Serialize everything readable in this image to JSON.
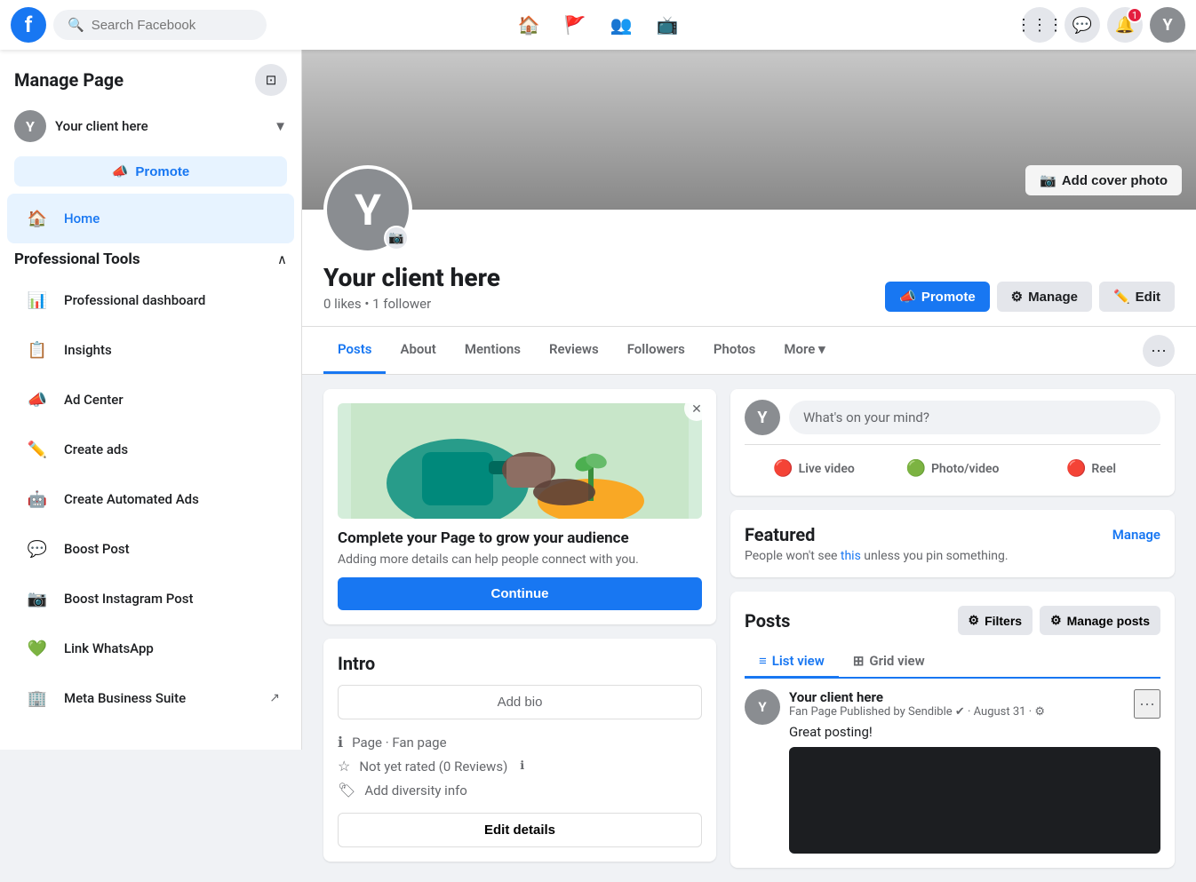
{
  "topnav": {
    "logo": "f",
    "search_placeholder": "Search Facebook",
    "icons": [
      "home",
      "flag",
      "people",
      "tv"
    ],
    "right_icons": [
      "grid",
      "messenger",
      "bell",
      "avatar"
    ],
    "notification_count": "1",
    "avatar_letter": "Y"
  },
  "sidebar": {
    "title": "Manage Page",
    "page_name": "Your client here",
    "avatar_letter": "Y",
    "promote_label": "Promote",
    "nav_items": [
      {
        "id": "home",
        "label": "Home",
        "icon": "🏠",
        "active": true
      },
      {
        "id": "professional-tools-header",
        "label": "Professional Tools",
        "is_section": true
      },
      {
        "id": "professional-dashboard",
        "label": "Professional dashboard",
        "icon": "📊"
      },
      {
        "id": "insights",
        "label": "Insights",
        "icon": "📋"
      },
      {
        "id": "ad-center",
        "label": "Ad Center",
        "icon": "📣"
      },
      {
        "id": "create-ads",
        "label": "Create ads",
        "icon": "✏️"
      },
      {
        "id": "create-automated-ads",
        "label": "Create Automated Ads",
        "icon": "🤖"
      },
      {
        "id": "boost-post",
        "label": "Boost Post",
        "icon": "💬"
      },
      {
        "id": "boost-instagram",
        "label": "Boost Instagram Post",
        "icon": "📷"
      },
      {
        "id": "link-whatsapp",
        "label": "Link WhatsApp",
        "icon": "💚"
      },
      {
        "id": "meta-business-suite",
        "label": "Meta Business Suite",
        "icon": "🏢",
        "external": true
      }
    ]
  },
  "cover": {
    "add_cover_label": "Add cover photo",
    "camera_icon": "📷"
  },
  "profile": {
    "avatar_letter": "Y",
    "name": "Your client here",
    "meta": "0 likes • 1 follower",
    "actions": {
      "promote": "Promote",
      "manage": "Manage",
      "edit": "Edit"
    }
  },
  "tabs": [
    {
      "id": "posts",
      "label": "Posts",
      "active": true
    },
    {
      "id": "about",
      "label": "About"
    },
    {
      "id": "mentions",
      "label": "Mentions"
    },
    {
      "id": "reviews",
      "label": "Reviews"
    },
    {
      "id": "followers",
      "label": "Followers"
    },
    {
      "id": "photos",
      "label": "Photos"
    },
    {
      "id": "more",
      "label": "More ▾"
    }
  ],
  "grow_card": {
    "title": "Complete your Page to grow your audience",
    "desc": "Adding more details can help people connect with you.",
    "continue_label": "Continue"
  },
  "intro": {
    "title": "Intro",
    "add_bio_label": "Add bio",
    "page_type": "Page · Fan page",
    "rating": "Not yet rated (0 Reviews)",
    "diversity_info": "Add diversity info",
    "edit_details_label": "Edit details"
  },
  "composer": {
    "avatar_letter": "Y",
    "placeholder": "What's on your mind?",
    "actions": [
      {
        "id": "live-video",
        "label": "Live video",
        "icon": "🔴"
      },
      {
        "id": "photo-video",
        "label": "Photo/video",
        "icon": "🟢"
      },
      {
        "id": "reel",
        "label": "Reel",
        "icon": "🔴"
      }
    ]
  },
  "featured": {
    "title": "Featured",
    "desc": "People won't see ",
    "desc_link": "this",
    "desc_end": " unless you pin something.",
    "manage_label": "Manage"
  },
  "posts_section": {
    "title": "Posts",
    "filters_label": "Filters",
    "manage_posts_label": "Manage posts",
    "view_tabs": [
      {
        "id": "list",
        "label": "List view",
        "active": true
      },
      {
        "id": "grid",
        "label": "Grid view"
      }
    ],
    "post": {
      "page_name": "Your client here",
      "meta": "Fan Page",
      "published_by": "Published by Sendible",
      "date": "· August 31 ·",
      "text": "Great posting!"
    }
  }
}
